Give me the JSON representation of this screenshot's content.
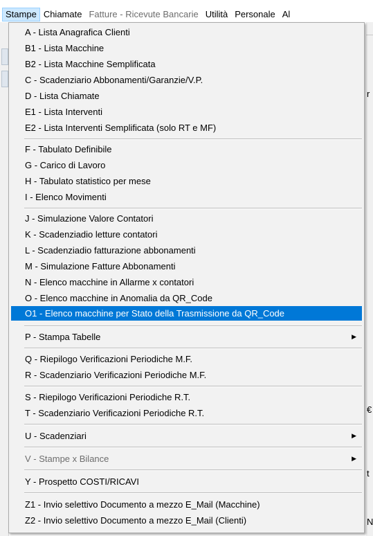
{
  "menubar": {
    "items": [
      {
        "label": "Stampe",
        "state": "active"
      },
      {
        "label": "Chiamate",
        "state": "normal"
      },
      {
        "label": "Fatture - Ricevute Bancarie",
        "state": "disabled"
      },
      {
        "label": "Utilità",
        "state": "normal"
      },
      {
        "label": "Personale",
        "state": "normal"
      },
      {
        "label": "Al",
        "state": "normal"
      }
    ]
  },
  "menu": {
    "items": [
      {
        "label": "A - Lista Anagrafica Clienti"
      },
      {
        "label": "B1 - Lista Macchine"
      },
      {
        "label": "B2 - Lista Macchine Semplificata"
      },
      {
        "label": "C - Scadenziario Abbonamenti/Garanzie/V.P."
      },
      {
        "label": "D - Lista Chiamate"
      },
      {
        "label": "E1 - Lista Interventi"
      },
      {
        "label": "E2 - Lista Interventi Semplificata (solo RT e MF)"
      },
      {
        "label": "F - Tabulato Definibile"
      },
      {
        "label": "G - Carico di Lavoro"
      },
      {
        "label": "H - Tabulato statistico per mese"
      },
      {
        "label": "I - Elenco Movimenti"
      },
      {
        "label": "J - Simulazione Valore Contatori"
      },
      {
        "label": "K - Scadenziadio letture contatori"
      },
      {
        "label": "L - Scadenziadio fatturazione abbonamenti"
      },
      {
        "label": "M - Simulazione Fatture Abbonamenti"
      },
      {
        "label": "N - Elenco macchine in Allarme x contatori"
      },
      {
        "label": "O - Elenco macchine in Anomalia da QR_Code"
      },
      {
        "label": "O1 - Elenco macchine per Stato della Trasmissione da QR_Code",
        "selected": true
      },
      {
        "label": "P - Stampa Tabelle",
        "submenu": true
      },
      {
        "label": "Q - Riepilogo Verificazioni Periodiche M.F."
      },
      {
        "label": "R - Scadenziario Verificazioni Periodiche M.F."
      },
      {
        "label": "S - Riepilogo Verificazioni Periodiche R.T."
      },
      {
        "label": "T - Scadenziario Verificazioni Periodiche R.T."
      },
      {
        "label": "U - Scadenziari",
        "submenu": true
      },
      {
        "label": "V - Stampe x Bilance",
        "submenu": true,
        "disabled": true
      },
      {
        "label": "Y - Prospetto COSTI/RICAVI"
      },
      {
        "label": "Z1 - Invio selettivo Documento a mezzo E_Mail (Macchine)"
      },
      {
        "label": "Z2 - Invio selettivo Documento a mezzo E_Mail (Clienti)"
      }
    ],
    "submenu_arrow_icon": "chevron-right-icon",
    "colors": {
      "selected_bg": "#0078d7",
      "selected_fg": "#ffffff",
      "menu_bg": "#f2f2f2",
      "disabled_fg": "#6d6d6d"
    }
  },
  "background": {
    "right_glyphs": [
      "r",
      "€",
      "t",
      "N"
    ]
  }
}
